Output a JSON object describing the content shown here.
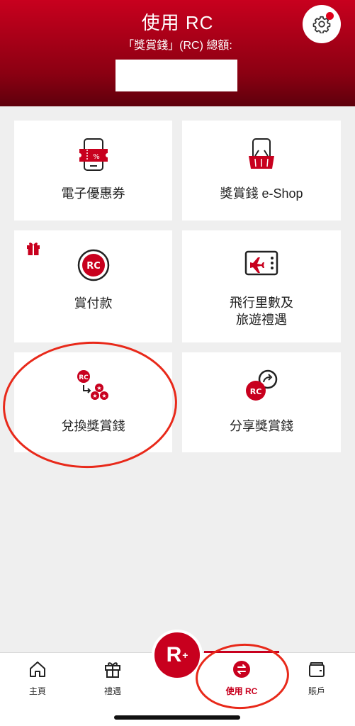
{
  "header": {
    "title": "使用 RC",
    "subtitle": "「獎賞錢」(RC) 總額:",
    "balance": ""
  },
  "tiles": [
    {
      "label": "電子優惠券",
      "icon": "phone-coupon-icon"
    },
    {
      "label": "獎賞錢 e-Shop",
      "icon": "phone-shopping-basket-icon"
    },
    {
      "label": "賞付款",
      "icon": "rc-coin-icon",
      "badge_icon": "gift-icon"
    },
    {
      "label": "飛行里數及\n旅遊禮遇",
      "line1": "飛行里數及",
      "line2": "旅遊禮遇",
      "icon": "airplane-ticket-icon"
    },
    {
      "label": "兌換獎賞錢",
      "icon": "rc-exchange-icon"
    },
    {
      "label": "分享獎賞錢",
      "icon": "rc-share-icon"
    }
  ],
  "tabbar": {
    "tabs": [
      {
        "label": "主頁",
        "icon": "home-icon"
      },
      {
        "label": "禮遇",
        "icon": "gift-icon"
      },
      {
        "label": "使用 RC",
        "icon": "exchange-icon",
        "active": true
      },
      {
        "label": "賬戶",
        "icon": "wallet-icon"
      }
    ],
    "fab_label": "R",
    "fab_sup": "+"
  },
  "colors": {
    "brand": "#c8001e",
    "annotation": "#e8291a"
  }
}
